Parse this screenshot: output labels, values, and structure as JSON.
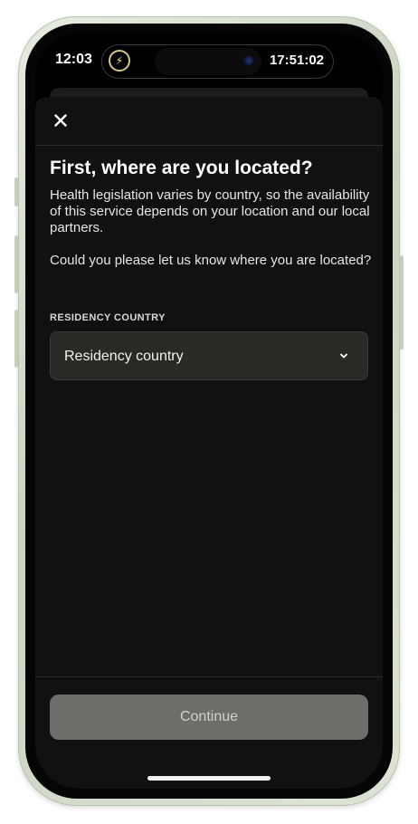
{
  "status_bar": {
    "time": "12:03",
    "live_activity_time": "17:51:02",
    "charging_icon": "lightning-bolt"
  },
  "header": {
    "close_icon": "close-x"
  },
  "content": {
    "title": "First, where are you located?",
    "paragraph1": "Health legislation varies by country, so the availability of this service depends on your location and our local partners.",
    "paragraph2": "Could you please let us know where you are located?",
    "field_label": "RESIDENCY COUNTRY",
    "select_placeholder": "Residency country",
    "select_icon": "chevron-down"
  },
  "footer": {
    "continue_label": "Continue"
  },
  "colors": {
    "sheet_background": "#111111",
    "select_background": "#2a2926",
    "button_disabled": "#6f6d6a"
  }
}
